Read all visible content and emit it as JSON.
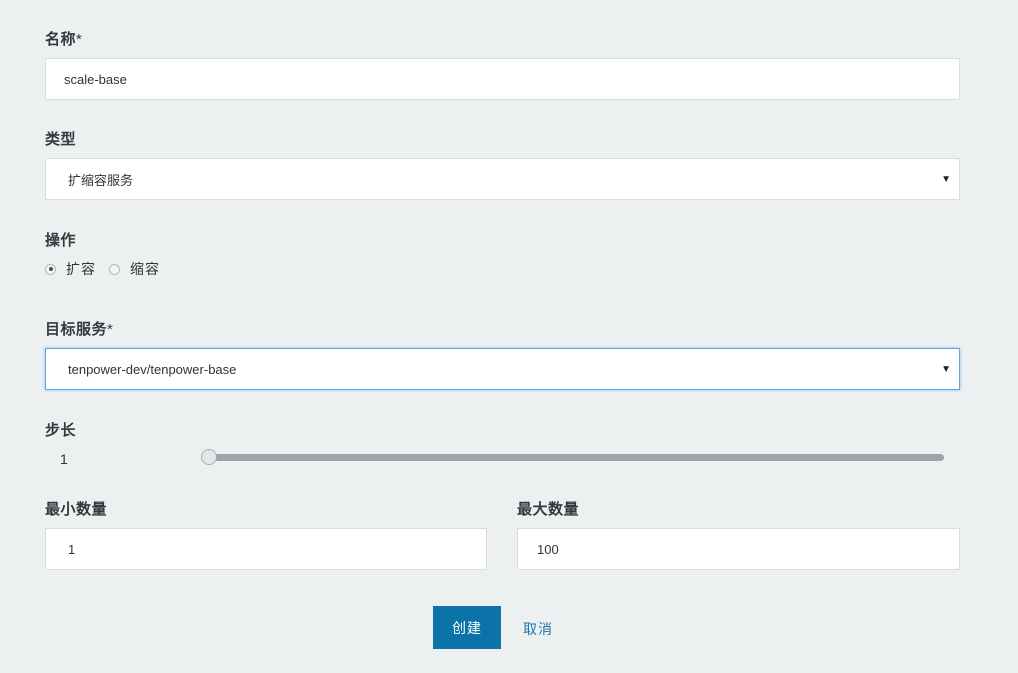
{
  "name": {
    "label": "名称",
    "required_mark": "*",
    "value": "scale-base"
  },
  "type": {
    "label": "类型",
    "selected": "扩缩容服务"
  },
  "operation": {
    "label": "操作",
    "options": [
      {
        "label": "扩容",
        "checked": true
      },
      {
        "label": "缩容",
        "checked": false
      }
    ]
  },
  "target_service": {
    "label": "目标服务",
    "required_mark": "*",
    "selected": "tenpower-dev/tenpower-base"
  },
  "step": {
    "label": "步长",
    "value": "1",
    "slider_fraction": 0
  },
  "min_count": {
    "label": "最小数量",
    "value": "1"
  },
  "max_count": {
    "label": "最大数量",
    "value": "100"
  },
  "buttons": {
    "create": "创建",
    "cancel": "取消"
  },
  "icons": {
    "dropdown": "caret-down-icon"
  },
  "colors": {
    "primary": "#0b73a8",
    "link": "#1a78ad",
    "focus_border": "#5aa6e6",
    "background": "#ecf0f1"
  }
}
